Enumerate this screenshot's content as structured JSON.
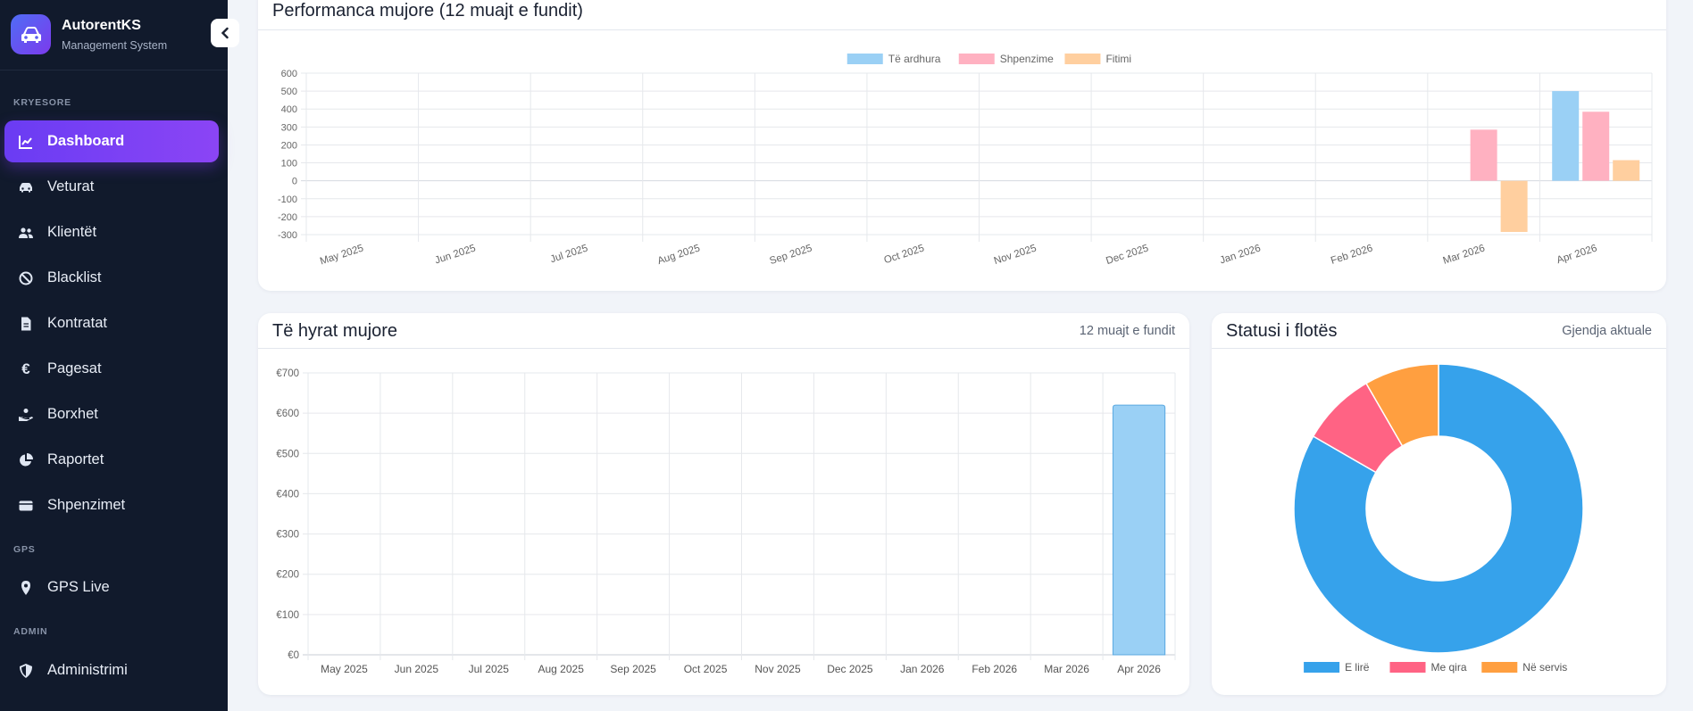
{
  "sidebar": {
    "brand_name": "AutorentKS",
    "brand_subtitle": "Management System",
    "sections": {
      "main": "KRYESORE",
      "gps": "GPS",
      "admin": "ADMIN"
    },
    "items": [
      {
        "label": "Dashboard",
        "icon": "chart-line-icon",
        "active": true
      },
      {
        "label": "Veturat",
        "icon": "car-icon"
      },
      {
        "label": "Klientët",
        "icon": "users-icon"
      },
      {
        "label": "Blacklist",
        "icon": "ban-icon"
      },
      {
        "label": "Kontratat",
        "icon": "document-icon"
      },
      {
        "label": "Pagesat",
        "icon": "euro-icon"
      },
      {
        "label": "Borxhet",
        "icon": "hand-coin-icon"
      },
      {
        "label": "Raportet",
        "icon": "pie-chart-icon"
      },
      {
        "label": "Shpenzimet",
        "icon": "wallet-icon"
      },
      {
        "label": "GPS Live",
        "icon": "map-pin-icon"
      },
      {
        "label": "Administrimi",
        "icon": "shield-icon"
      }
    ]
  },
  "performance": {
    "title": "Performanca mujore (12 muajt e fundit)"
  },
  "revenue": {
    "title": "Të hyrat mujore",
    "subtitle": "12 muajt e fundit"
  },
  "fleet": {
    "title": "Statusi i flotës",
    "subtitle": "Gjendja aktuale"
  },
  "chart_data": [
    {
      "type": "bar",
      "title": "Performanca mujore (12 muajt e fundit)",
      "categories": [
        "May 2025",
        "Jun 2025",
        "Jul 2025",
        "Aug 2025",
        "Sep 2025",
        "Oct 2025",
        "Nov 2025",
        "Dec 2025",
        "Jan 2026",
        "Feb 2026",
        "Mar 2026",
        "Apr 2026"
      ],
      "series": [
        {
          "name": "Të ardhura",
          "color": "#9ad0f5",
          "values": [
            0,
            0,
            0,
            0,
            0,
            0,
            0,
            0,
            0,
            0,
            0,
            500
          ]
        },
        {
          "name": "Shpenzime",
          "color": "#ffb1c1",
          "values": [
            0,
            0,
            0,
            0,
            0,
            0,
            0,
            0,
            0,
            0,
            285,
            385
          ]
        },
        {
          "name": "Fitimi",
          "color": "#ffcf9f",
          "values": [
            0,
            0,
            0,
            0,
            0,
            0,
            0,
            0,
            0,
            0,
            -285,
            115
          ]
        }
      ],
      "ylim": [
        -300,
        600
      ],
      "yticks": [
        "600",
        "500",
        "400",
        "300",
        "200",
        "100",
        "0",
        "-100",
        "-200",
        "-300"
      ],
      "legend": "top",
      "grid": true
    },
    {
      "type": "bar",
      "title": "Të hyrat mujore",
      "categories": [
        "May 2025",
        "Jun 2025",
        "Jul 2025",
        "Aug 2025",
        "Sep 2025",
        "Oct 2025",
        "Nov 2025",
        "Dec 2025",
        "Jan 2026",
        "Feb 2026",
        "Mar 2026",
        "Apr 2026"
      ],
      "series": [
        {
          "color": "#9ad0f5",
          "values": [
            0,
            0,
            0,
            0,
            0,
            0,
            0,
            0,
            0,
            0,
            0,
            620
          ]
        }
      ],
      "ylim": [
        0,
        700
      ],
      "yticks": [
        "€700",
        "€600",
        "€500",
        "€400",
        "€300",
        "€200",
        "€100",
        "€0"
      ],
      "grid": true
    },
    {
      "type": "pie",
      "title": "Statusi i flotës",
      "labels": [
        "E lirë",
        "Me qira",
        "Në servis"
      ],
      "values": [
        10,
        1,
        1
      ],
      "colors": [
        "#36a2eb",
        "#ff6384",
        "#ff9f40"
      ],
      "legend": "bottom"
    }
  ]
}
